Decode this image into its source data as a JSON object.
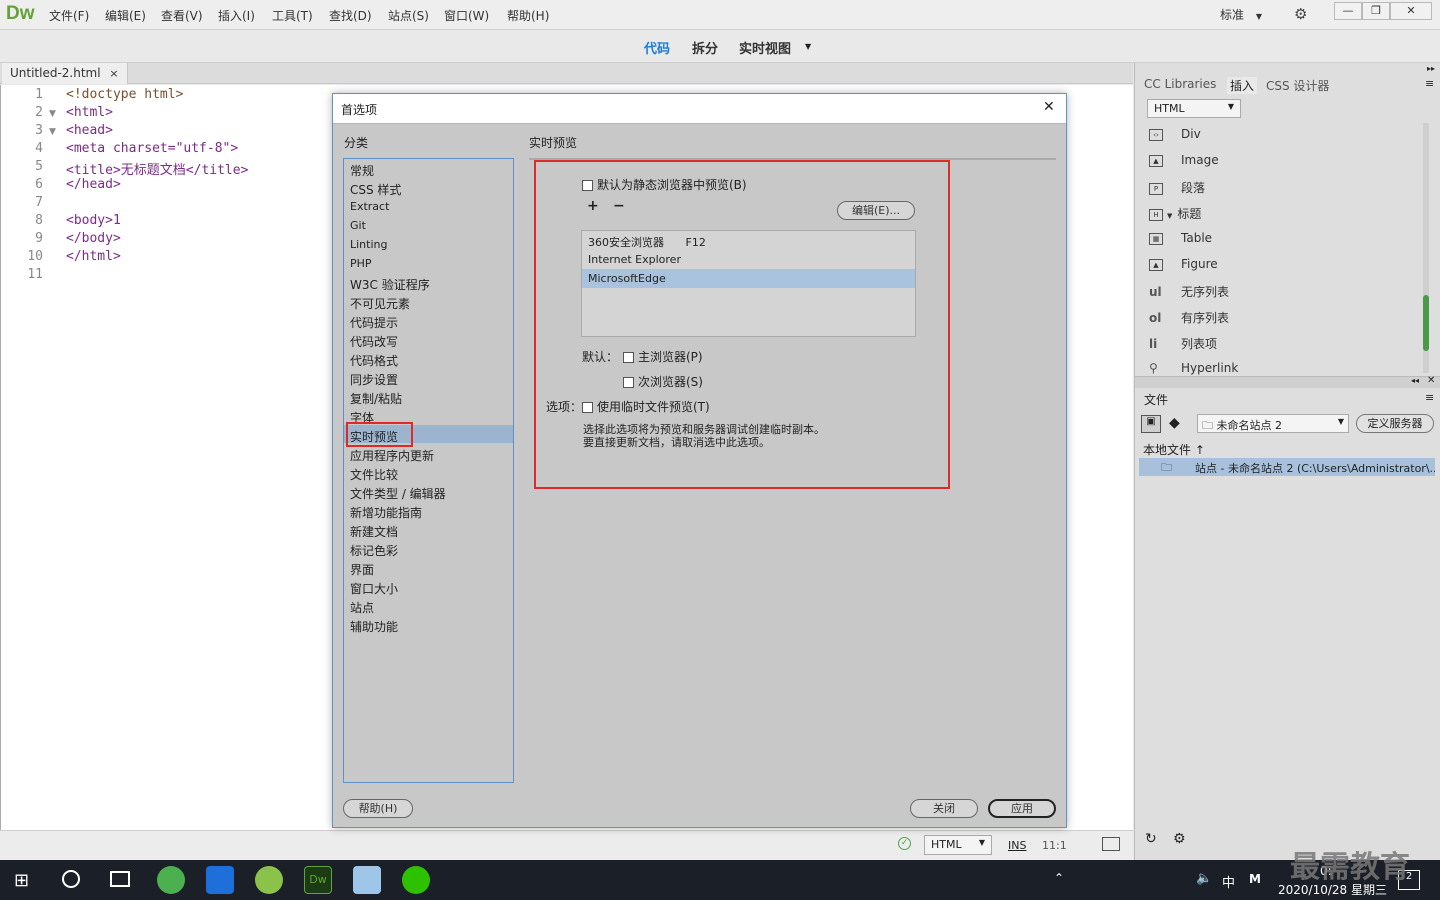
{
  "app": {
    "logo": "Dw",
    "menu": [
      "文件(F)",
      "编辑(E)",
      "查看(V)",
      "插入(I)",
      "工具(T)",
      "查找(D)",
      "站点(S)",
      "窗口(W)",
      "帮助(H)"
    ],
    "workspace": "标准",
    "window_controls": [
      "—",
      "❐",
      "✕"
    ]
  },
  "viewbar": {
    "code": "代码",
    "split": "拆分",
    "live": "实时视图"
  },
  "document": {
    "tab": "Untitled-2.html",
    "tab_close": "×",
    "line_numbers": [
      "1",
      "2",
      "3",
      "4",
      "5",
      "6",
      "7",
      "8",
      "9",
      "10",
      "11"
    ],
    "lines": [
      "<!doctype html>",
      "<html>",
      "<head>",
      "<meta charset=\"utf-8\">",
      "<title>无标题文档</title>",
      "</head>",
      "",
      "<body>1",
      "</body>",
      "</html>",
      ""
    ]
  },
  "status": {
    "language": "HTML",
    "mode": "INS",
    "position": "11:1"
  },
  "right_panel": {
    "tabs": [
      "CC Libraries",
      "插入",
      "CSS 设计器"
    ],
    "insert_category": "HTML",
    "insert_items": [
      {
        "icon": "div-icon",
        "label": "Div"
      },
      {
        "icon": "image-icon",
        "label": "Image"
      },
      {
        "icon": "paragraph-icon",
        "label": "段落"
      },
      {
        "icon": "heading-icon",
        "label": "标题"
      },
      {
        "icon": "table-icon",
        "label": "Table"
      },
      {
        "icon": "figure-icon",
        "label": "Figure"
      },
      {
        "icon": "ul",
        "label": "无序列表"
      },
      {
        "icon": "ol",
        "label": "有序列表"
      },
      {
        "icon": "li",
        "label": "列表项"
      },
      {
        "icon": "hyperlink-icon",
        "label": "Hyperlink"
      }
    ],
    "files_tab": "文件",
    "site_select": "未命名站点 2",
    "define_server": "定义服务器",
    "local_files": "本地文件 ↑",
    "site_row": "站点 - 未命名站点 2 (C:\\Users\\Administrator\\..."
  },
  "dialog": {
    "title": "首选项",
    "close": "✕",
    "category_label": "分类",
    "section_label": "实时预览",
    "categories": [
      "常规",
      "CSS 样式",
      "Extract",
      "Git",
      "Linting",
      "PHP",
      "W3C 验证程序",
      "不可见元素",
      "代码提示",
      "代码改写",
      "代码格式",
      "同步设置",
      "复制/粘贴",
      "字体",
      "实时预览",
      "应用程序内更新",
      "文件比较",
      "文件类型 / 编辑器",
      "新增功能指南",
      "新建文档",
      "标记色彩",
      "界面",
      "窗口大小",
      "站点",
      "辅助功能"
    ],
    "selected_category": "实时预览",
    "static_preview_checkbox": "默认为静态浏览器中预览(B)",
    "add": "+",
    "remove": "−",
    "edit_button": "编辑(E)...",
    "browsers": [
      {
        "name": "360安全浏览器",
        "key": "F12"
      },
      {
        "name": "Internet Explorer",
        "key": ""
      },
      {
        "name": "MicrosoftEdge",
        "key": ""
      }
    ],
    "selected_browser": "MicrosoftEdge",
    "default_label": "默认：",
    "primary_browser": "主浏览器(P)",
    "secondary_browser": "次浏览器(S)",
    "options_label": "选项：",
    "temp_file": "使用临时文件预览(T)",
    "description": "选择此选项将为预览和服务器调试创建临时副本。要直接更新文档，请取消选中此选项。",
    "help": "帮助(H)",
    "close_button": "关闭",
    "apply": "应用",
    "highlight_color": "#e02a2a"
  },
  "taskbar": {
    "ime": "中",
    "ime2": "M",
    "time": "0:",
    "date": "2020/10/28 星期三",
    "notification_count": "2",
    "watermark": "最需教育"
  }
}
